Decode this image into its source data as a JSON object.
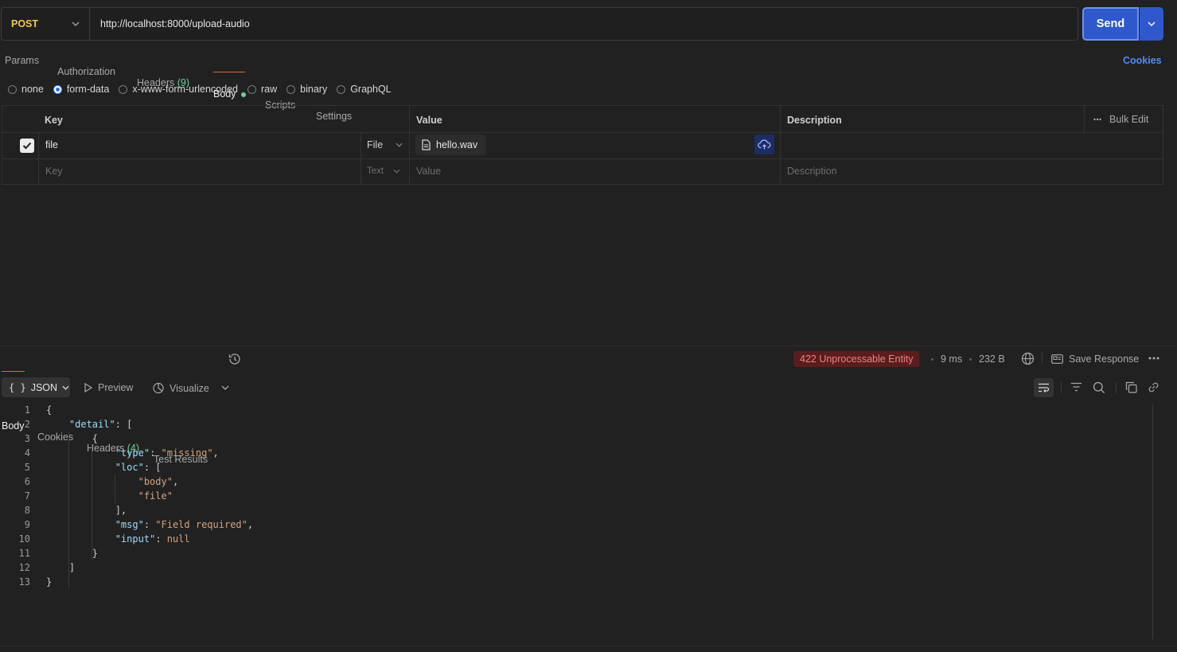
{
  "request": {
    "method": "POST",
    "url": "http://localhost:8000/upload-audio",
    "send_label": "Send"
  },
  "request_tabs": [
    {
      "label": "Params"
    },
    {
      "label": "Authorization"
    },
    {
      "label": "Headers",
      "count": "(9)"
    },
    {
      "label": "Body"
    },
    {
      "label": "Scripts"
    },
    {
      "label": "Settings"
    }
  ],
  "cookies_label": "Cookies",
  "body_types": [
    "none",
    "form-data",
    "x-www-form-urlencoded",
    "raw",
    "binary",
    "GraphQL"
  ],
  "body_type_selected": "form-data",
  "table": {
    "headers": {
      "key": "Key",
      "value": "Value",
      "description": "Description",
      "bulk_edit": "Bulk Edit"
    },
    "rows": [
      {
        "key": "file",
        "type": "File",
        "value": "hello.wav",
        "description": ""
      }
    ],
    "placeholder": {
      "key": "Key",
      "type": "Text",
      "value": "Value",
      "description": "Description"
    }
  },
  "response_tabs": [
    {
      "label": "Body"
    },
    {
      "label": "Cookies"
    },
    {
      "label": "Headers",
      "count": "(4)"
    },
    {
      "label": "Test Results"
    }
  ],
  "response_meta": {
    "status": "422 Unprocessable Entity",
    "time": "9 ms",
    "size": "232 B",
    "save_label": "Save Response"
  },
  "response_toolbar": {
    "format": "JSON",
    "preview": "Preview",
    "visualize": "Visualize"
  },
  "code_lines": [
    "{",
    "    \"detail\": [",
    "        {",
    "            \"type\": \"missing\",",
    "            \"loc\": [",
    "                \"body\",",
    "                \"file\"",
    "            ],",
    "            \"msg\": \"Field required\",",
    "            \"input\": null",
    "        }",
    "    ]",
    "}"
  ]
}
